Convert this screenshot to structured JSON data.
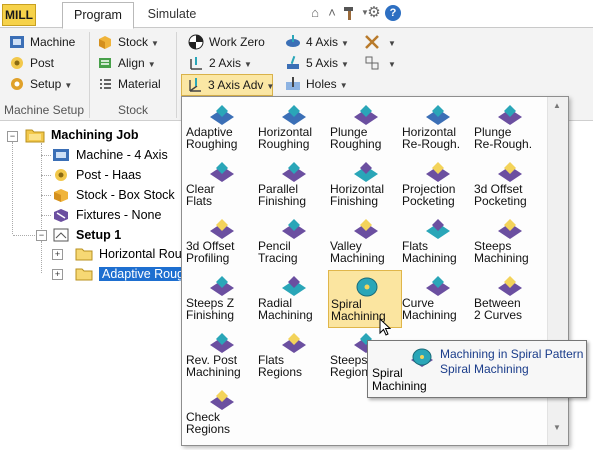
{
  "tabs": {
    "mill": "MILL",
    "program": "Program",
    "simulate": "Simulate"
  },
  "title_icons": [
    "home-icon",
    "chevron-up-icon",
    "hammer-icon",
    "gear-icon",
    "help-icon"
  ],
  "help_glyph": "?",
  "ribbon": {
    "machine": "Machine",
    "post": "Post",
    "setup": "Setup",
    "stock": "Stock",
    "align": "Align",
    "material": "Material",
    "work_zero": "Work Zero",
    "two_axis": "2 Axis",
    "three_axis_adv": "3 Axis Adv",
    "four_axis": "4 Axis",
    "five_axis": "5 Axis",
    "holes": "Holes",
    "group_machine_setup": "Machine Setup",
    "group_stock": "Stock"
  },
  "tree": {
    "root": "Machining Job",
    "machine": "Machine - 4 Axis",
    "post": "Post - Haas",
    "stock": "Stock - Box Stock",
    "fixtures": "Fixtures - None",
    "setup": "Setup 1",
    "op1": "Horizontal Roug",
    "op2": "Adaptive Rough"
  },
  "menu_items": [
    {
      "l1": "Adaptive",
      "l2": "Roughing"
    },
    {
      "l1": "Horizontal",
      "l2": "Roughing"
    },
    {
      "l1": "Plunge",
      "l2": "Roughing"
    },
    {
      "l1": "Horizontal",
      "l2": "Re-Rough."
    },
    {
      "l1": "Plunge",
      "l2": "Re-Rough."
    },
    {
      "l1": "Clear",
      "l2": "Flats"
    },
    {
      "l1": "Parallel",
      "l2": "Finishing"
    },
    {
      "l1": "Horizontal",
      "l2": "Finishing"
    },
    {
      "l1": "Projection",
      "l2": "Pocketing"
    },
    {
      "l1": "3d Offset",
      "l2": "Pocketing"
    },
    {
      "l1": "3d Offset",
      "l2": "Profiling"
    },
    {
      "l1": "Pencil",
      "l2": "Tracing"
    },
    {
      "l1": "Valley",
      "l2": "Machining"
    },
    {
      "l1": "Flats",
      "l2": "Machining"
    },
    {
      "l1": "Steeps",
      "l2": "Machining"
    },
    {
      "l1": "Steeps  Z",
      "l2": "Finishing"
    },
    {
      "l1": "Radial",
      "l2": "Machining"
    },
    {
      "l1": "Spiral",
      "l2": "Machining"
    },
    {
      "l1": "Curve",
      "l2": "Machining"
    },
    {
      "l1": "Between",
      "l2": "2 Curves"
    },
    {
      "l1": "Rev. Post",
      "l2": "Machining"
    },
    {
      "l1": "Flats",
      "l2": "Regions"
    },
    {
      "l1": "Steeps",
      "l2": "Regions"
    },
    {
      "l1": "",
      "l2": ""
    },
    {
      "l1": "",
      "l2": ""
    },
    {
      "l1": "Check",
      "l2": "Regions"
    }
  ],
  "tooltip": {
    "title_l1": "Spiral",
    "title_l2": "Machining",
    "description": "Machining in Spiral Pattern",
    "name": "Spiral Machining"
  },
  "colors": {
    "accent_yellow": "#f6d24a",
    "highlight": "#fbe5a0",
    "selection_blue": "#1e6fd0",
    "tool_teal": "#2aa6b8",
    "tool_purple": "#6b4fa0"
  }
}
